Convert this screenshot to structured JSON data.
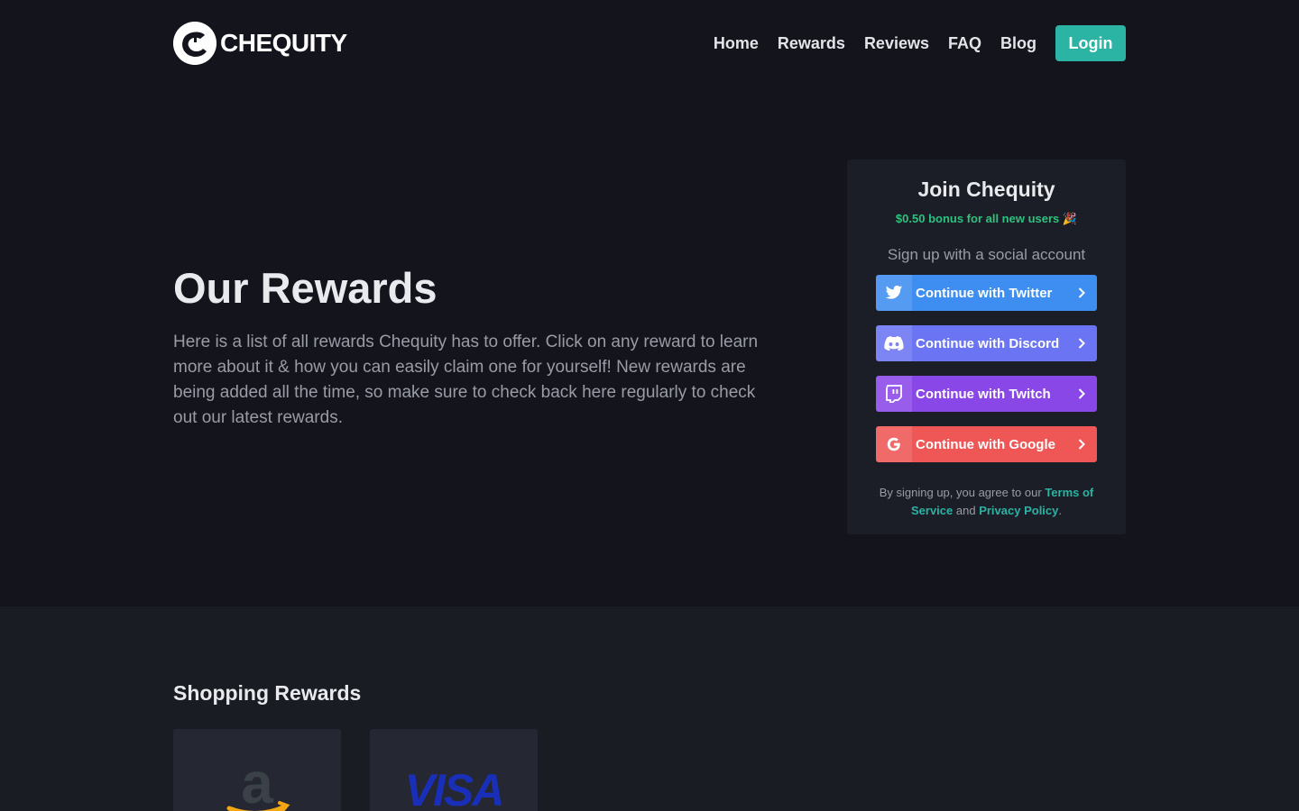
{
  "brand": {
    "name": "CHEQUITY"
  },
  "nav": {
    "items": [
      "Home",
      "Rewards",
      "Reviews",
      "FAQ",
      "Blog"
    ],
    "login_label": "Login"
  },
  "hero": {
    "title": "Our Rewards",
    "description": "Here is a list of all rewards Chequity has to offer. Click on any reward to learn more about it & how you can easily claim one for yourself! New rewards are being added all the time, so make sure to check back here regularly to check out our latest rewards."
  },
  "join": {
    "title": "Join Chequity",
    "bonus": "$0.50 bonus for all new users 🎉",
    "subtitle": "Sign up with a social account",
    "buttons": [
      {
        "label": "Continue with Twitter",
        "icon": "twitter-icon",
        "color": "#3d8ef0"
      },
      {
        "label": "Continue with Discord",
        "icon": "discord-icon",
        "color": "#6b74f2"
      },
      {
        "label": "Continue with Twitch",
        "icon": "twitch-icon",
        "color": "#8a47e8"
      },
      {
        "label": "Continue with Google",
        "icon": "google-icon",
        "color": "#ef5656"
      }
    ],
    "terms_prefix": "By signing up, you agree to our",
    "terms_link": "Terms of Service",
    "terms_and": "and",
    "privacy_link": "Privacy Policy",
    "terms_suffix": "."
  },
  "shopping": {
    "title": "Shopping Rewards",
    "rewards": [
      {
        "name": "amazon",
        "logo": "amazon-logo"
      },
      {
        "name": "visa",
        "logo_text": "VISA"
      }
    ]
  },
  "colors": {
    "accent": "#2bb3a3",
    "bonus": "#2ec27e",
    "background": "#13141c"
  }
}
